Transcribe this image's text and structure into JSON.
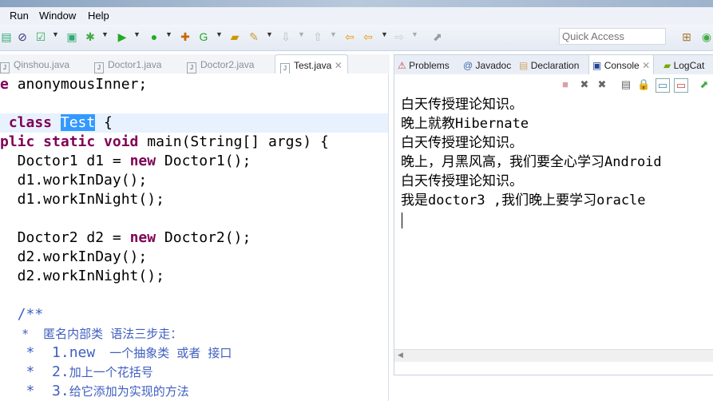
{
  "menu": {
    "items": [
      "Run",
      "Window",
      "Help"
    ]
  },
  "toolbar": {
    "quick_access_placeholder": "Quick Access"
  },
  "editor": {
    "tabs": [
      {
        "label": "Qinshou.java"
      },
      {
        "label": "Doctor1.java"
      },
      {
        "label": "Doctor2.java"
      },
      {
        "label": "Test.java",
        "active": true
      }
    ],
    "lines": {
      "l0a": "e ",
      "l0b": "anonymousInner;",
      "l1a": " class ",
      "l1b": "Test",
      "l1c": " {",
      "l2a": "plic static void",
      "l2b": " main(String[] args) {",
      "l3a": "  Doctor1 d1 = ",
      "l3b": "new",
      "l3c": " Doctor1();",
      "l4": "  d1.workInDay();",
      "l5": "  d1.workInNight();",
      "l6a": "  Doctor2 d2 = ",
      "l6b": "new",
      "l6c": " Doctor2();",
      "l7": "  d2.workInDay();",
      "l8": "  d2.workInNight();",
      "l9": "  /**",
      "l10": "   *  匿名内部类 语法三步走：",
      "l11a": "   *  1.new",
      "l11b": "  一个抽象类 或者 接口",
      "l12a": "   *  2.",
      "l12b": "加上一个花括号",
      "l13a": "   *  3.",
      "l13b": "给它添加为实现的方法"
    }
  },
  "console": {
    "tabs": [
      {
        "label": "Problems"
      },
      {
        "label": "Javadoc"
      },
      {
        "label": "Declaration"
      },
      {
        "label": "Console",
        "active": true
      },
      {
        "label": "LogCat"
      }
    ],
    "output": [
      "白天传授理论知识。",
      "晚上就教Hibernate",
      "白天传授理论知识。",
      "晚上，月黑风高，我们要全心学习Android",
      "白天传授理论知识。",
      "我是doctor3 ,我们晚上要学习oracle"
    ]
  }
}
